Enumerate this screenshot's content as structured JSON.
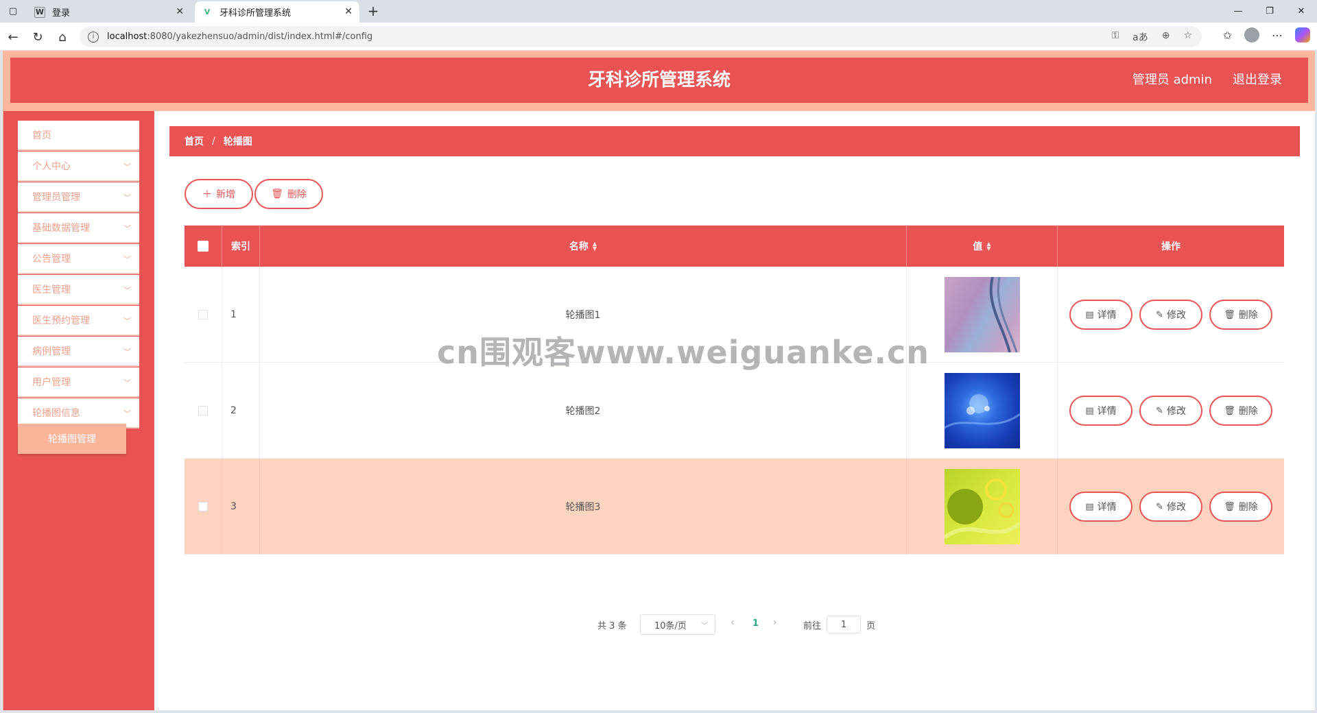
{
  "browser": {
    "tabs": [
      {
        "title": "登录",
        "favicon": "W"
      },
      {
        "title": "牙科诊所管理系统",
        "favicon": "V"
      }
    ],
    "url_host": "localhost",
    "url_rest": ":8080/yakezhensuo/admin/dist/index.html#/config"
  },
  "header": {
    "title": "牙科诊所管理系统",
    "user": "管理员 admin",
    "logout": "退出登录"
  },
  "sidebar": {
    "items": [
      {
        "label": "首页",
        "has_children": false
      },
      {
        "label": "个人中心",
        "has_children": true
      },
      {
        "label": "管理员管理",
        "has_children": true
      },
      {
        "label": "基础数据管理",
        "has_children": true
      },
      {
        "label": "公告管理",
        "has_children": true
      },
      {
        "label": "医生管理",
        "has_children": true
      },
      {
        "label": "医生预约管理",
        "has_children": true
      },
      {
        "label": "病例管理",
        "has_children": true
      },
      {
        "label": "用户管理",
        "has_children": true
      },
      {
        "label": "轮播图信息",
        "has_children": true
      }
    ],
    "active_sub": "轮播图管理"
  },
  "breadcrumb": {
    "home": "首页",
    "sep": "/",
    "current": "轮播图"
  },
  "toolbar": {
    "add": "新增",
    "delete": "删除"
  },
  "table": {
    "headers": {
      "index": "索引",
      "name": "名称",
      "value": "值",
      "ops": "操作"
    },
    "rows": [
      {
        "index": "1",
        "name": "轮播图1",
        "image": "thumb-1"
      },
      {
        "index": "2",
        "name": "轮播图2",
        "image": "thumb-2"
      },
      {
        "index": "3",
        "name": "轮播图3",
        "image": "thumb-3"
      }
    ],
    "row_actions": {
      "detail": "详情",
      "edit": "修改",
      "delete": "删除"
    },
    "highlighted_row": 3
  },
  "pagination": {
    "total": "共 3 条",
    "page_size": "10条/页",
    "current_page": "1",
    "goto_label": "前往",
    "goto_value": "1",
    "page_unit": "页"
  },
  "watermark": "cn围观客www.weiguanke.cn",
  "colors": {
    "primary": "#ea5354",
    "header_border": "#fbb89e",
    "highlight_row": "#fdd4c0",
    "menu_text": "#f29f8b"
  }
}
